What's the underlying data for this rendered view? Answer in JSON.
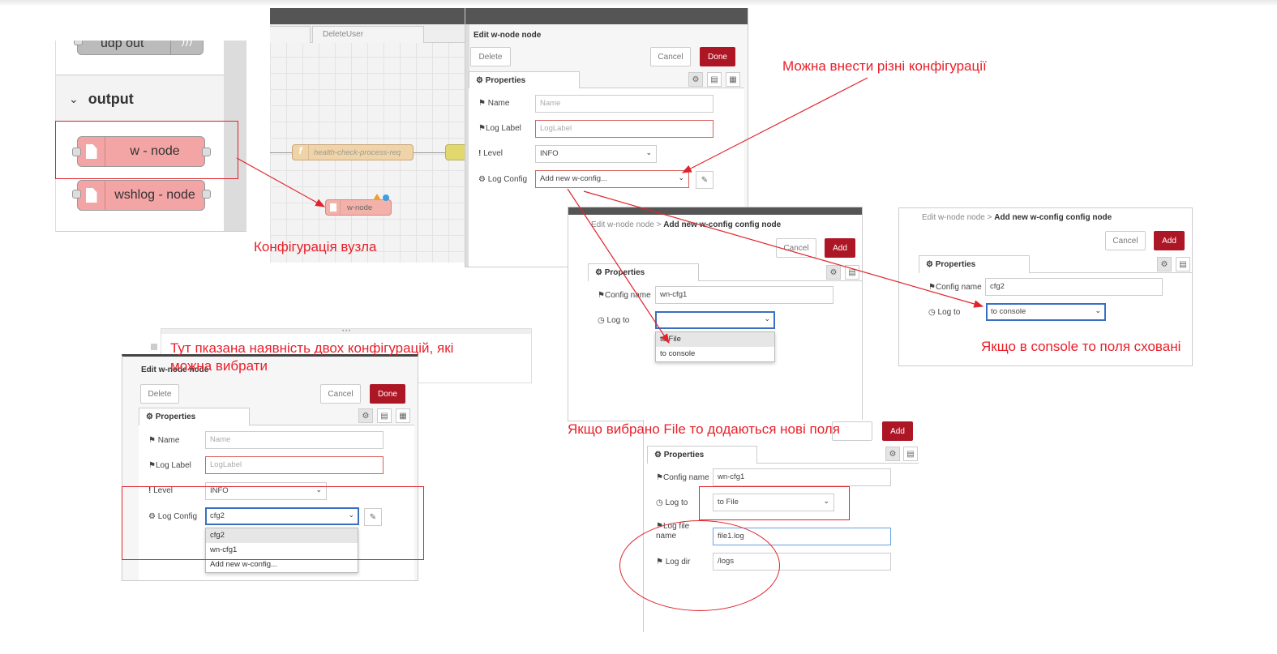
{
  "palette": {
    "top_node_label": "udp out",
    "category_label": "output",
    "nodes": [
      {
        "label": "w - node"
      },
      {
        "label": "wshlog - node"
      }
    ]
  },
  "workspace": {
    "tab_label": "DeleteUser",
    "function_node_label": "health-check-process-req",
    "wnode_label": "w-node"
  },
  "tray1": {
    "title": "Edit w-node node",
    "delete_label": "Delete",
    "cancel_label": "Cancel",
    "done_label": "Done",
    "properties_label": "Properties",
    "fields": {
      "name_label": "Name",
      "name_placeholder": "Name",
      "loglabel_label": "Log Label",
      "loglabel_placeholder": "LogLabel",
      "level_label": "Level",
      "level_value": "INFO",
      "logconfig_label": "Log Config",
      "logconfig_value": "Add new w-config..."
    }
  },
  "tray2": {
    "breadcrumb_prefix": "Edit w-node node >",
    "title": "Add new w-config config node",
    "cancel_label": "Cancel",
    "add_label": "Add",
    "properties_label": "Properties",
    "config_name_label": "Config name",
    "config_name_value": "wn-cfg1",
    "log_to_label": "Log to",
    "log_to_value": "",
    "options": [
      "to File",
      "to console"
    ]
  },
  "tray3": {
    "breadcrumb_prefix": "Edit w-node node >",
    "title": "Add new w-config config node",
    "cancel_label": "Cancel",
    "add_label": "Add",
    "properties_label": "Properties",
    "config_name_label": "Config name",
    "config_name_value": "cfg2",
    "log_to_label": "Log to",
    "log_to_value": "to console"
  },
  "tray4": {
    "title": "Edit w-node node",
    "delete_label": "Delete",
    "cancel_label": "Cancel",
    "done_label": "Done",
    "properties_label": "Properties",
    "name_label": "Name",
    "name_placeholder": "Name",
    "loglabel_label": "Log Label",
    "loglabel_placeholder": "LogLabel",
    "level_label": "Level",
    "level_value": "INFO",
    "logconfig_label": "Log Config",
    "logconfig_value": "cfg2",
    "options": [
      "cfg2",
      "wn-cfg1",
      "Add new w-config..."
    ]
  },
  "tray5": {
    "add_label": "Add",
    "properties_label": "Properties",
    "config_name_label": "Config name",
    "config_name_value": "wn-cfg1",
    "log_to_label": "Log to",
    "log_to_value": "to File",
    "log_file_label_1": "Log file",
    "log_file_label_2": "name",
    "log_file_value": "file1.log",
    "log_dir_label": "Log dir",
    "log_dir_value": "/logs"
  },
  "annotations": {
    "node_config": "Конфігурація вузла",
    "different_configs": "Можна внести різні конфігурації",
    "console_hidden": "Якщо в console то поля сховані",
    "two_configs_line1": "Тут пказана наявність двох конфігурацій, які",
    "two_configs_line2": "можна вибрати",
    "file_new_fields": "Якщо вибрано File то додаються нові поля"
  },
  "colors": {
    "annotation": "#e8202a",
    "primary_button": "#ad1625",
    "node_fill": "#f3a4a4"
  }
}
